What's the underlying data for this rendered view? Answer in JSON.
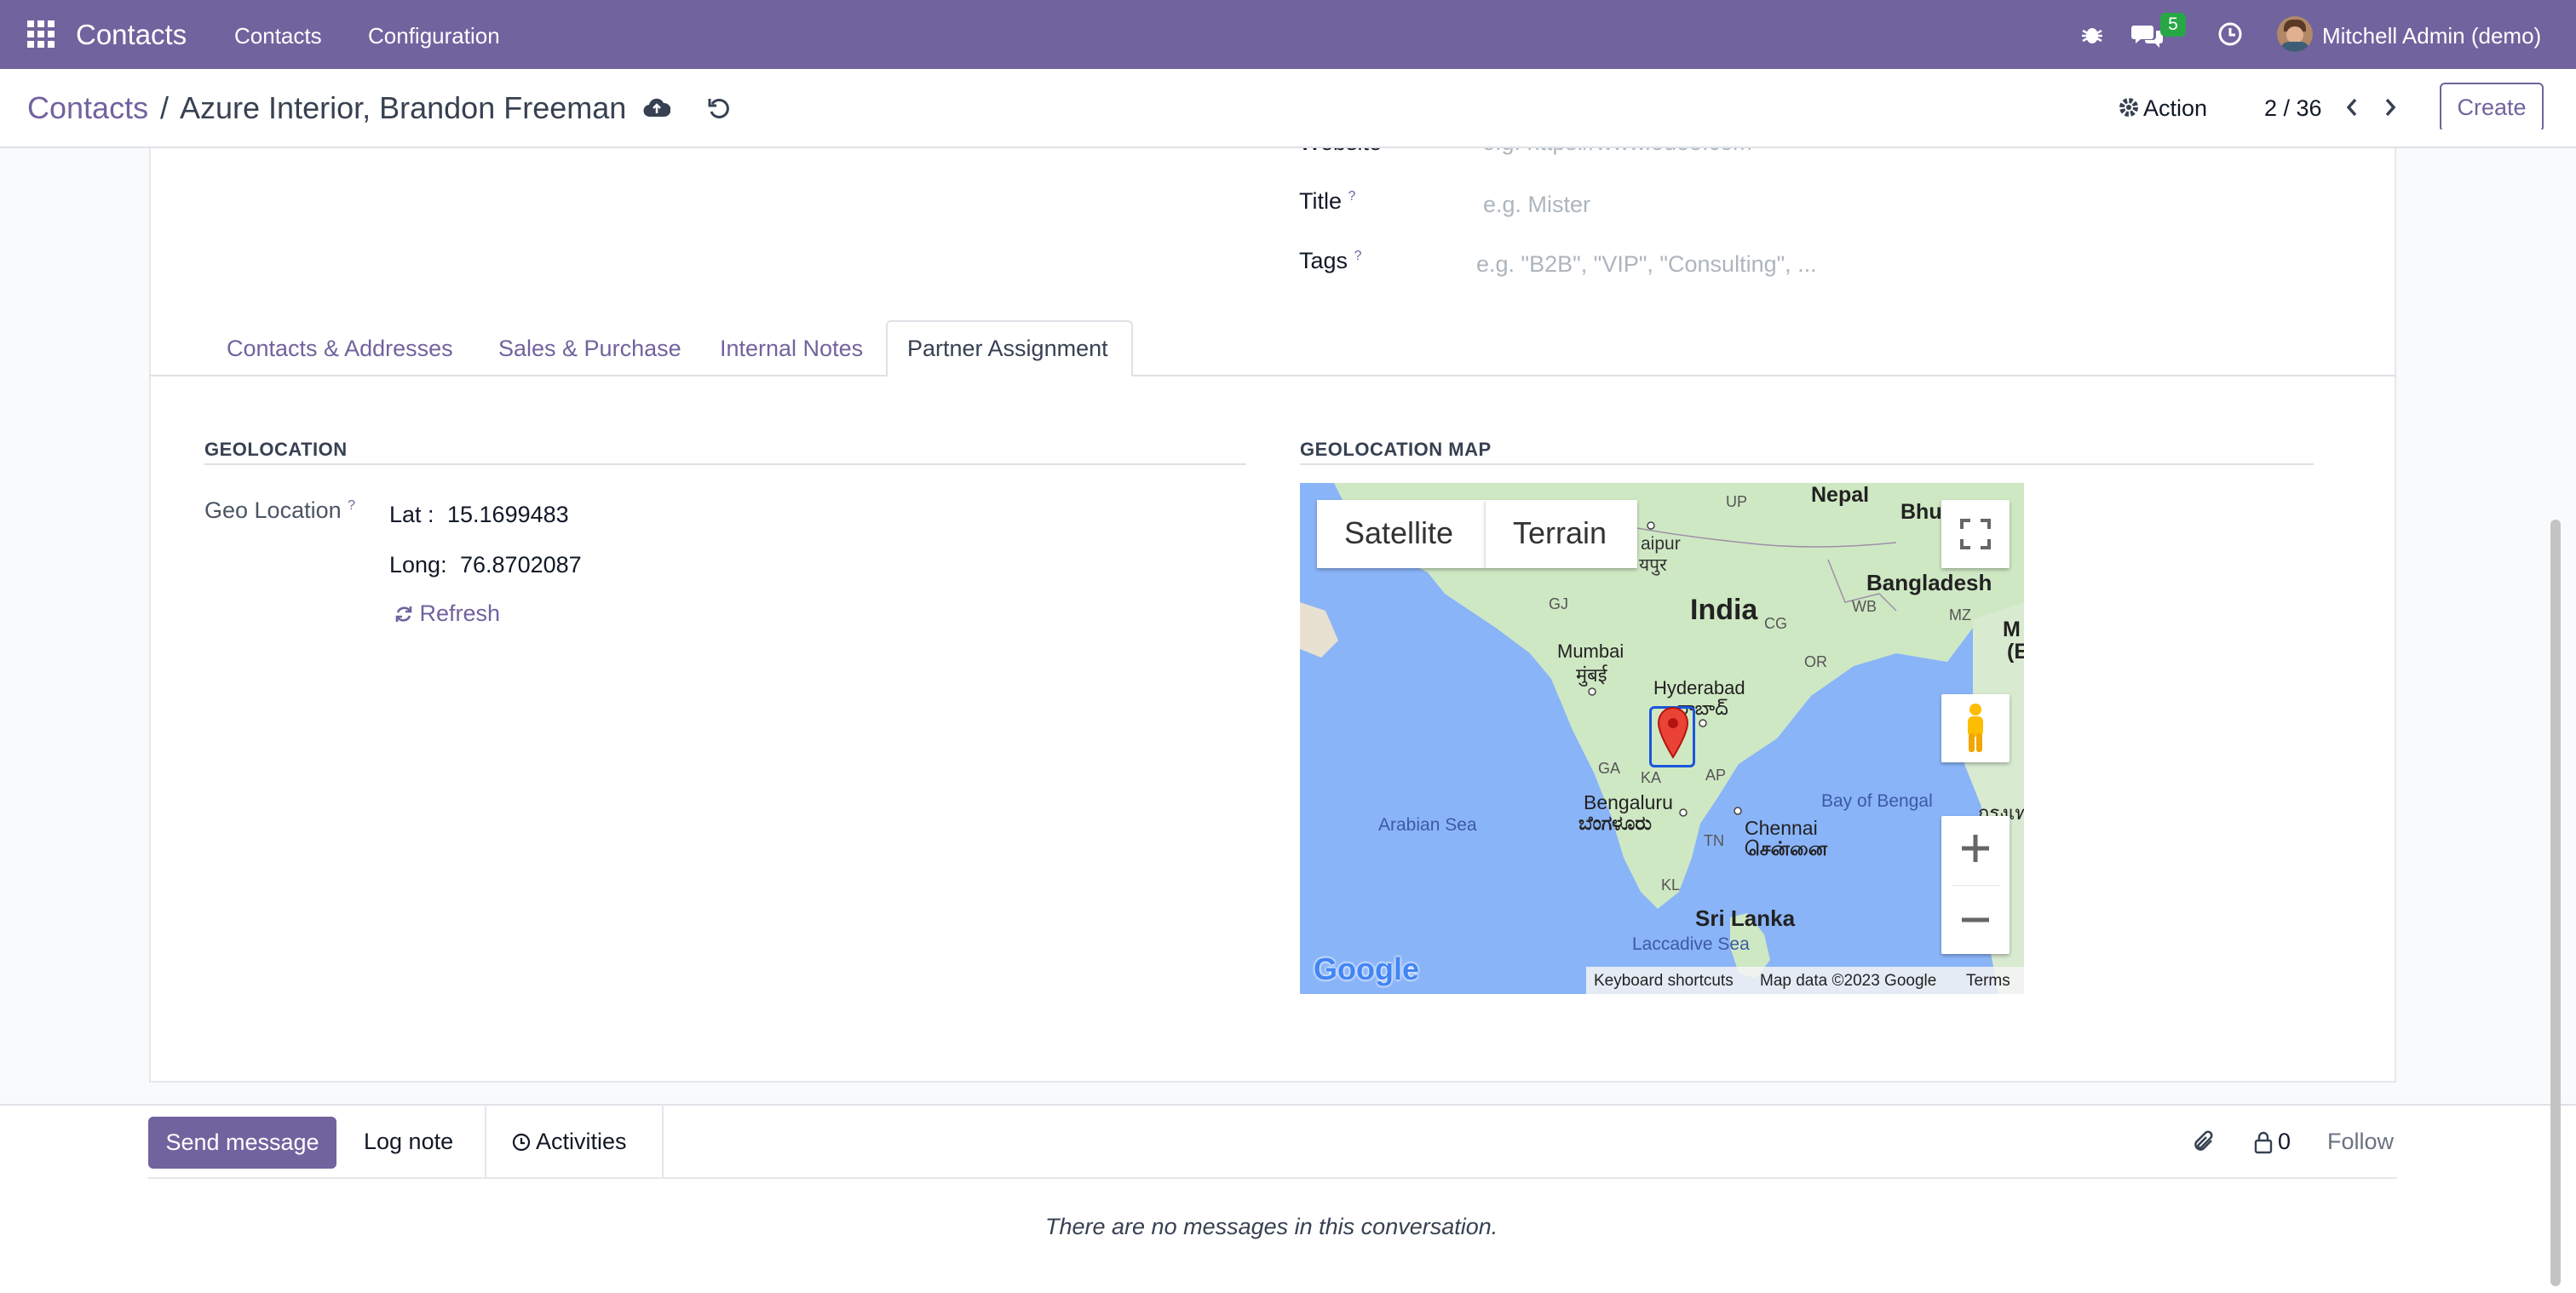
{
  "navbar": {
    "app_name": "Contacts",
    "menu": [
      "Contacts",
      "Configuration"
    ],
    "chat_count": "5",
    "user": "Mitchell Admin (demo)"
  },
  "breadcrumb": {
    "root": "Contacts",
    "separator": "/",
    "current": "Azure Interior, Brandon Freeman"
  },
  "control": {
    "action_label": "Action",
    "pager": "2 / 36",
    "create_label": "Create"
  },
  "form": {
    "website_label": "Website",
    "website_placeholder": "e.g. https://www.odoo.com",
    "title_label": "Title",
    "title_placeholder": "e.g. Mister",
    "tags_label": "Tags",
    "tags_placeholder": "e.g. \"B2B\", \"VIP\", \"Consulting\", ...",
    "help_mark": "?"
  },
  "tabs": [
    "Contacts & Addresses",
    "Sales & Purchase",
    "Internal Notes",
    "Partner Assignment"
  ],
  "geolocation": {
    "section_title": "GEOLOCATION",
    "geo_label": "Geo Location",
    "lat_label": "Lat :",
    "lat_value": "15.1699483",
    "long_label": "Long:",
    "long_value": "76.8702087",
    "refresh_label": "Refresh"
  },
  "map": {
    "section_title": "GEOLOCATION MAP",
    "type_buttons": [
      "Satellite",
      "Terrain"
    ],
    "labels": {
      "nepal": "Nepal",
      "bhutan": "Bhu",
      "jaipur": "aipur",
      "jaipur_local": "यपुर",
      "bangladesh": "Bangladesh",
      "india": "India",
      "mumbai": "Mumbai",
      "mumbai_local": "मुंबई",
      "hyderabad": "Hyderabad",
      "hyderabad_local": "రాబాద్",
      "bengaluru": "Bengaluru",
      "bengaluru_local": "ಬೆಂಗಳೂರು",
      "chennai": "Chennai",
      "chennai_local": "சென்னை",
      "arabian_sea": "Arabian Sea",
      "bay_of_bengal": "Bay of Bengal",
      "sri_lanka": "Sri Lanka",
      "laccadive_sea": "Laccadive Sea",
      "myanmar_partial": "M",
      "myanmar_partial2": "(E",
      "thai_partial": "กรุงเท",
      "states": [
        "UP",
        "GJ",
        "CG",
        "WB",
        "MZ",
        "OR",
        "GA",
        "KA",
        "AP",
        "TN",
        "KL"
      ]
    },
    "google_logo": "Google",
    "footer": [
      "Keyboard shortcuts",
      "Map data ©2023 Google",
      "Terms"
    ]
  },
  "chatter": {
    "send_message": "Send message",
    "log_note": "Log note",
    "activities": "Activities",
    "followers_count": "0",
    "follow": "Follow",
    "empty_message": "There are no messages in this conversation."
  },
  "colors": {
    "brand": "#71639e",
    "map_water": "#8ab4f8",
    "map_land": "#cfe8c4"
  }
}
